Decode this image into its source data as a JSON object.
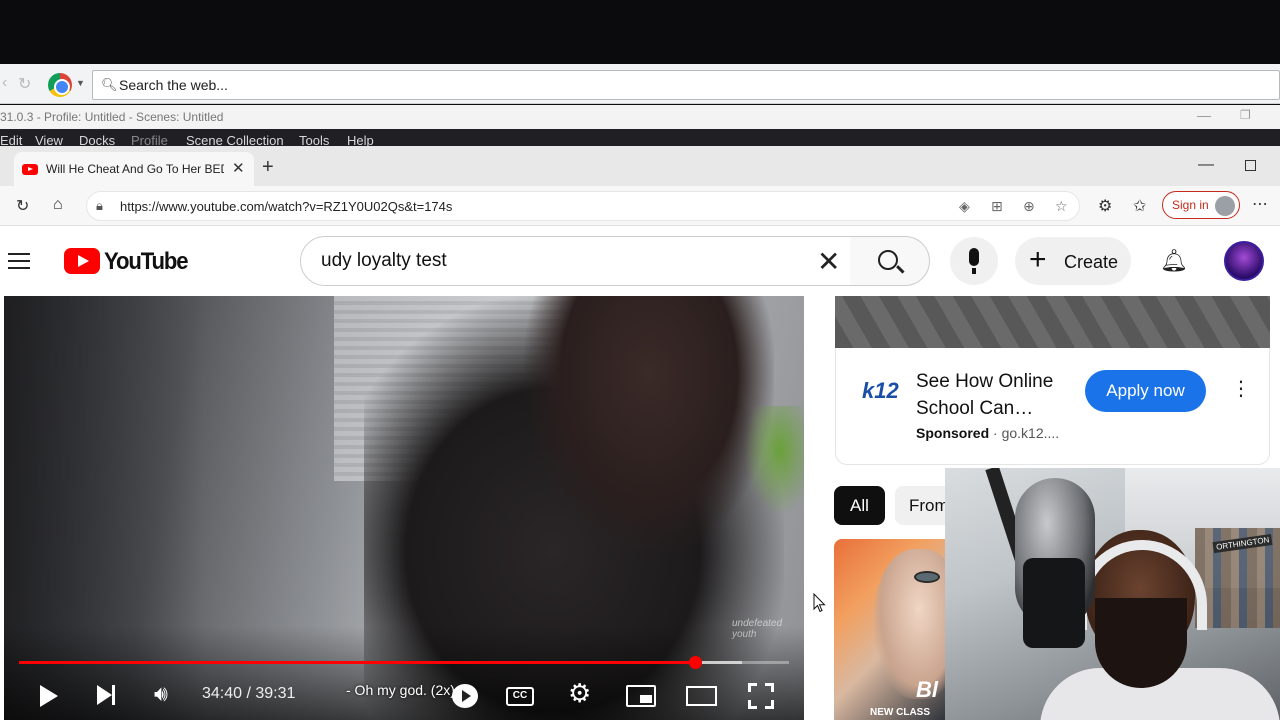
{
  "outer_browser": {
    "search_placeholder": "Search the web..."
  },
  "obs": {
    "title": "31.0.3 - Profile: Untitled - Scenes: Untitled",
    "menu": [
      "Edit",
      "View",
      "Docks",
      "Profile",
      "Scene Collection",
      "Tools",
      "Help"
    ]
  },
  "edge": {
    "tab_title": "Will He Cheat And Go To Her BED",
    "url": "https://www.youtube.com/watch?v=RZ1Y0U02Qs&t=174s",
    "signin_label": "Sign in"
  },
  "youtube": {
    "logo_text": "YouTube",
    "search_query": "udy loyalty test",
    "create_label": "Create"
  },
  "player": {
    "time": "34:40 / 39:31",
    "subtitle": "- Oh my god. (2x)",
    "progress_fraction": 0.878,
    "watermark": "undefeated youth"
  },
  "ad": {
    "brand": "k12",
    "title": "See How Online School Can…",
    "sponsored_label": "Sponsored",
    "domain": "go.k12....",
    "cta": "Apply now"
  },
  "chips": [
    "All",
    "From"
  ],
  "thumbnail": {
    "caption": "NEW CLASS",
    "text": "Bl"
  },
  "webcam": {
    "sign": "ORTHINGTON"
  },
  "colors": {
    "youtube_red": "#ff0000",
    "progress_red": "#ff0000",
    "cta_blue": "#1a73e8",
    "edge_signin_red": "#c42b1c"
  }
}
